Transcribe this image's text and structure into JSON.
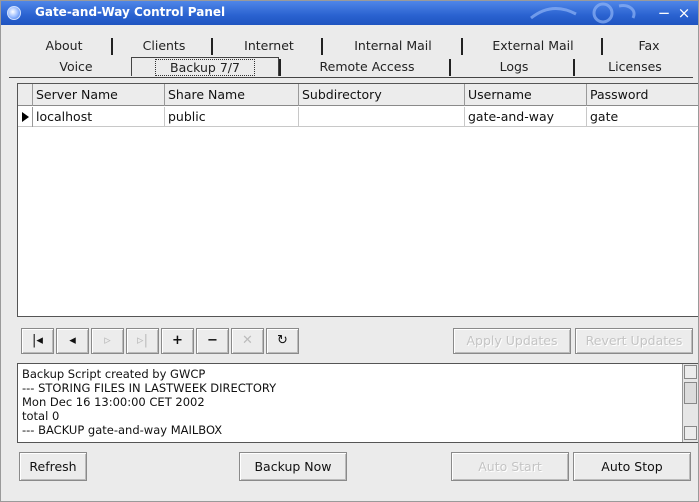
{
  "window": {
    "title": "Gate-and-Way Control Panel",
    "controls": {
      "minimize": "−",
      "close": "×"
    }
  },
  "tabs": {
    "row1": [
      "About",
      "Clients",
      "Internet",
      "Internal Mail",
      "External Mail",
      "Fax"
    ],
    "row2": [
      "Voice",
      "Backup 7/7",
      "Remote Access",
      "Logs",
      "Licenses"
    ],
    "active": "Backup 7/7"
  },
  "table": {
    "columns": [
      "Server Name",
      "Share Name",
      "Subdirectory",
      "Username",
      "Password"
    ],
    "rows": [
      [
        "localhost",
        "public",
        "",
        "gate-and-way",
        "gate"
      ]
    ]
  },
  "navigator": {
    "first": "|◂",
    "prior": "◂",
    "next": "▹",
    "last": "▹|",
    "insert": "+",
    "delete": "−",
    "cancel": "✕",
    "refresh": "↻",
    "apply_updates": "Apply Updates",
    "revert_updates": "Revert Updates"
  },
  "log": {
    "lines": [
      "Backup Script created by GWCP",
      "--- STORING FILES IN LASTWEEK DIRECTORY",
      "Mon Dec 16 13:00:00 CET 2002",
      "total 0",
      "--- BACKUP gate-and-way MAILBOX"
    ]
  },
  "buttons": {
    "refresh": "Refresh",
    "backup_now": "Backup Now",
    "auto_start": "Auto Start",
    "auto_stop": "Auto Stop"
  },
  "colors": {
    "titlebar": "#2a62d0",
    "window_bg": "#ebebeb"
  }
}
